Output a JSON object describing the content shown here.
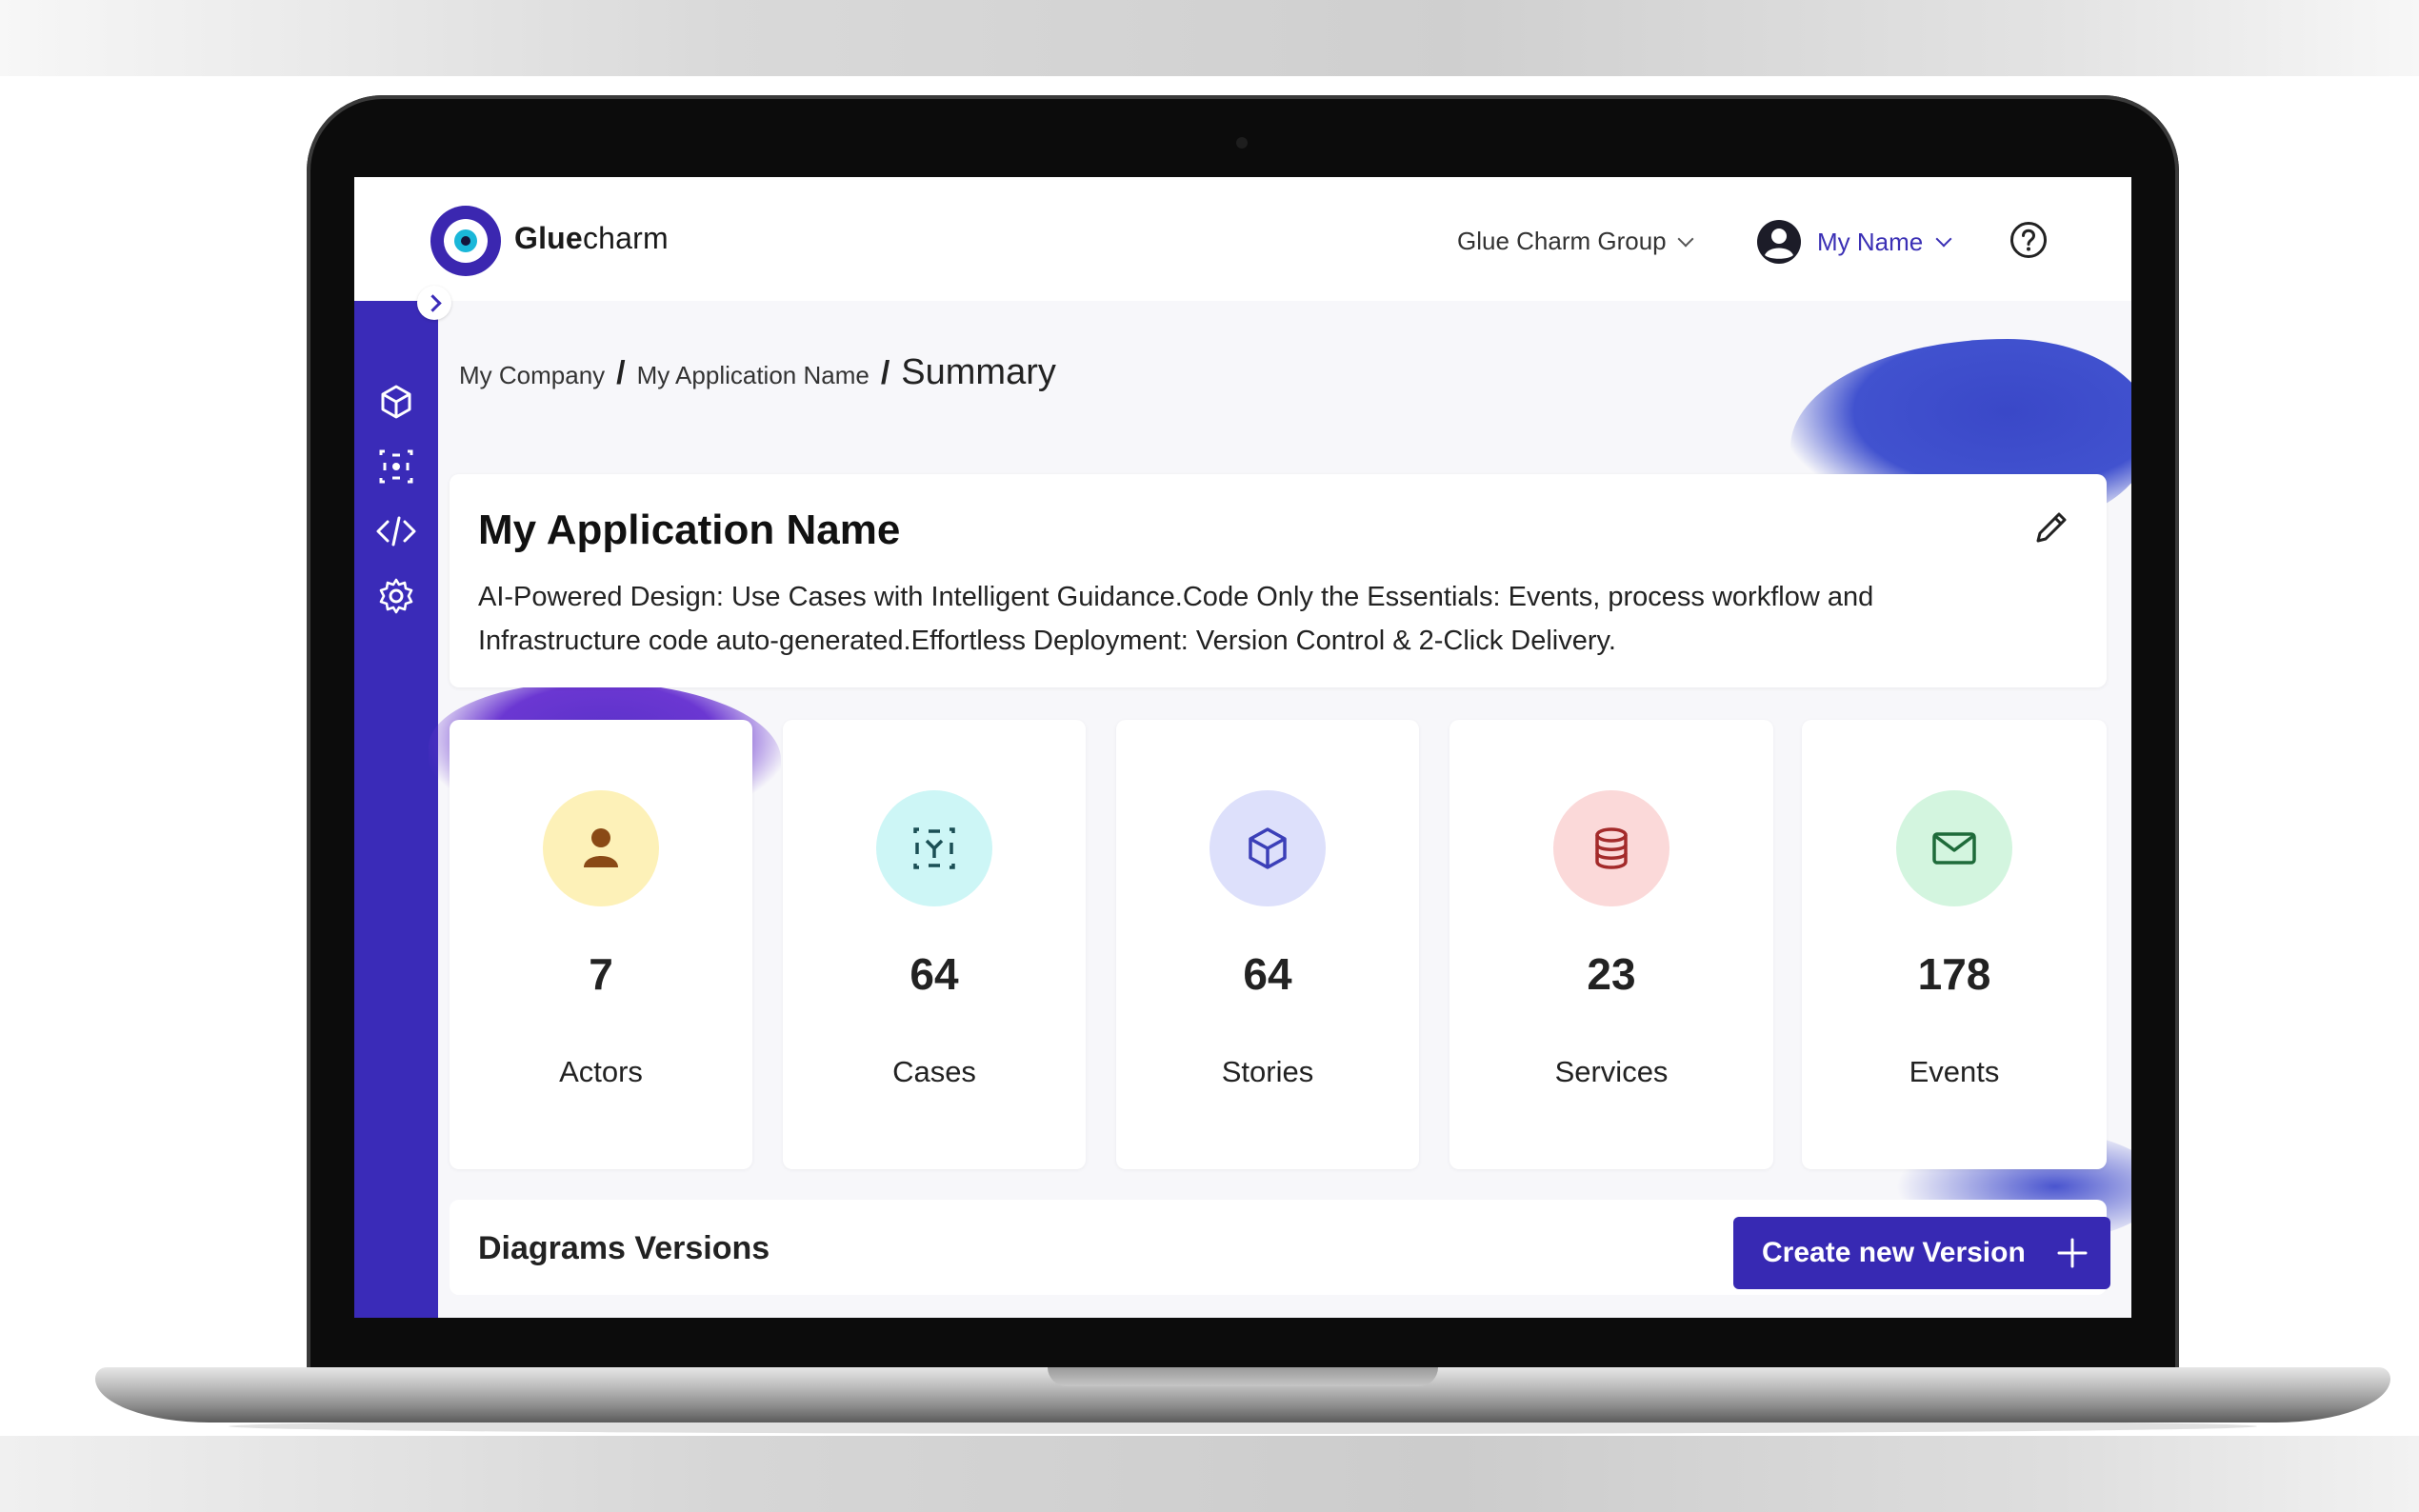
{
  "brand": {
    "bold": "Glue",
    "rest": "charm"
  },
  "header": {
    "org_name": "Glue Charm Group",
    "user_name": "My Name"
  },
  "breadcrumb": {
    "company": "My Company",
    "separator": "/",
    "application": "My Application Name",
    "current": "Summary"
  },
  "app": {
    "title": "My Application Name",
    "description": "AI-Powered Design: Use Cases with Intelligent Guidance.Code Only the Essentials: Events, process workflow and Infrastructure code auto-generated.Effortless Deployment: Version Control & 2-Click Delivery."
  },
  "stats": [
    {
      "value": "7",
      "label": "Actors",
      "icon": "person-icon",
      "bg": "#fdf1b8",
      "fg": "#8a4a16"
    },
    {
      "value": "64",
      "label": "Cases",
      "icon": "use-case-icon",
      "bg": "#cdf6f6",
      "fg": "#1b4f55"
    },
    {
      "value": "64",
      "label": "Stories",
      "icon": "cube-icon",
      "bg": "#dde0fb",
      "fg": "#3b3fb8"
    },
    {
      "value": "23",
      "label": "Services",
      "icon": "database-icon",
      "bg": "#fbd9d9",
      "fg": "#a32a2a"
    },
    {
      "value": "178",
      "label": "Events",
      "icon": "envelope-icon",
      "bg": "#d3f5df",
      "fg": "#1e6b3a"
    }
  ],
  "versions": {
    "title": "Diagrams Versions",
    "create_label": "Create new Version"
  },
  "sidebar": {
    "items": [
      "cube-icon",
      "use-case-icon",
      "code-icon",
      "gear-icon"
    ]
  },
  "colors": {
    "accent": "#3a2bb8",
    "link": "#3b30b5"
  }
}
